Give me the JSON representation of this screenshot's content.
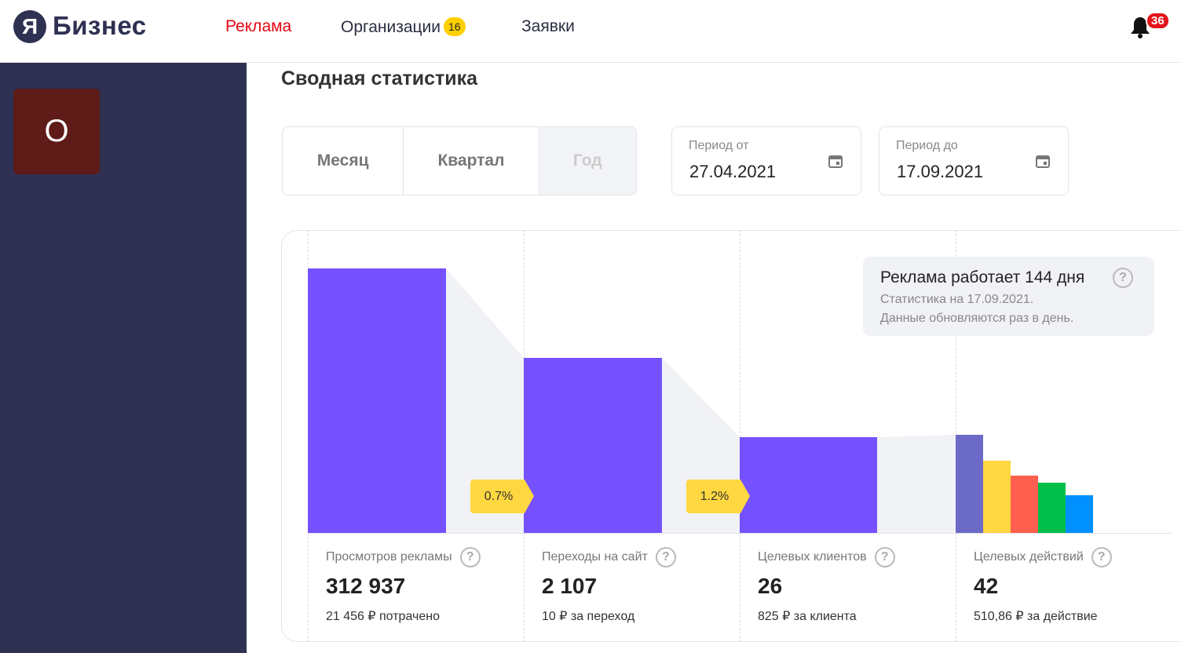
{
  "header": {
    "logo_letter": "Я",
    "logo_text": "Бизнес",
    "nav": [
      {
        "label": "Реклама",
        "active": true
      },
      {
        "label": "Организации",
        "badge": "16"
      },
      {
        "label": "Заявки"
      }
    ],
    "notifications": "36",
    "accent": "#e30611"
  },
  "sidebar": {
    "avatar_letter": "О",
    "avatar_color": "#5e1b17",
    "bg": "#2f3152"
  },
  "page": {
    "title": "Сводная статистика",
    "periods": [
      "Месяц",
      "Квартал",
      "Год"
    ],
    "selected_period": "Год",
    "date_from": {
      "label": "Период от",
      "value": "27.04.2021"
    },
    "date_to": {
      "label": "Период до",
      "value": "17.09.2021"
    }
  },
  "info": {
    "title": "Реклама работает 144 дня",
    "line1": "Статистика на 17.09.2021.",
    "line2": "Данные обновляются раз в день."
  },
  "funnel": {
    "conversions": [
      "0.7%",
      "1.2%"
    ],
    "stats": [
      {
        "label": "Просмотров рекламы",
        "value": "312 937",
        "sub": "21 456 ₽ потрачено"
      },
      {
        "label": "Переходы на сайт",
        "value": "2 107",
        "sub": "10 ₽ за переход"
      },
      {
        "label": "Целевых клиентов",
        "value": "26",
        "sub": "825 ₽ за клиента"
      },
      {
        "label": "Целевых действий",
        "value": "42",
        "sub": "510,86 ₽ за действие"
      }
    ],
    "bar_color": "#7551ff",
    "action_colors": [
      "#6b6bc7",
      "#ffd740",
      "#ff5f4f",
      "#00c04b",
      "#0090ff"
    ]
  }
}
